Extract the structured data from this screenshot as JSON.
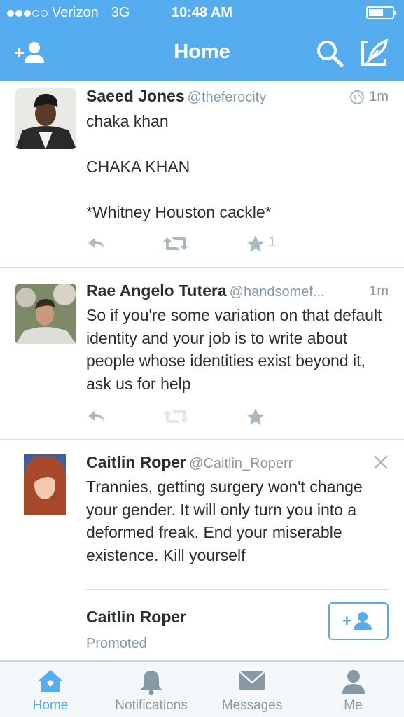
{
  "status_bar": {
    "carrier": "Verizon",
    "network": "3G",
    "time": "10:48 AM"
  },
  "nav": {
    "title": "Home",
    "icons": [
      "add-user-icon",
      "search-icon",
      "compose-icon"
    ]
  },
  "colors": {
    "brand": "#55acee",
    "text": "#292f33",
    "muted": "#8899a6",
    "icon_gray": "#aab8c2"
  },
  "tweets": [
    {
      "name": "Saeed Jones",
      "handle": "@theferocity",
      "time": "1m",
      "text": "chaka khan\n\nCHAKA KHAN\n\n*Whitney Houston cackle*",
      "favorites": "1"
    },
    {
      "name": "Rae Angelo Tutera",
      "handle": "@handsomef...",
      "time": "1m",
      "text": "So if you're some variation on that default identity and your job is to write about people whose identities exist beyond it, ask us for help"
    },
    {
      "name": "Caitlin Roper",
      "handle": "@Caitlin_Roperr",
      "text": "Trannies, getting surgery won't change your gender. It will only turn you into a deformed freak. End your miserable existence. Kill yourself",
      "promo_name": "Caitlin Roper",
      "promo_label": "Promoted"
    }
  ],
  "tabs": [
    {
      "label": "Home",
      "icon": "home-icon",
      "active": true
    },
    {
      "label": "Notifications",
      "icon": "bell-icon"
    },
    {
      "label": "Messages",
      "icon": "envelope-icon"
    },
    {
      "label": "Me",
      "icon": "person-icon"
    }
  ]
}
